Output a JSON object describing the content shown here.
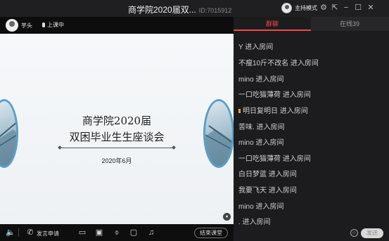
{
  "window": {
    "title": "商学院2020届双...",
    "room_id": "ID:7015912",
    "host_mode": "主持模式",
    "icons": [
      "settings-icon",
      "popout-icon",
      "minimize-icon",
      "maximize-icon",
      "close-icon"
    ]
  },
  "teacher": {
    "name": "芋头",
    "status": "上课中"
  },
  "slide": {
    "title_line1": "商学院2020届",
    "title_line2": "双困毕业生生座谈会",
    "date": "2020年6月"
  },
  "toolbar": {
    "apply_speak": "发言申请",
    "end_class": "结束课堂",
    "icons": [
      "speaker-icon",
      "phone-icon",
      "camera-icon",
      "screen-share-icon",
      "mic-icon",
      "chat-icon",
      "music-icon"
    ]
  },
  "sidebar": {
    "tabs": [
      {
        "label": "群聊",
        "active": true
      },
      {
        "label": "在线39",
        "active": false
      }
    ],
    "messages": [
      {
        "text": "Y 进入房间"
      },
      {
        "text": "不瘦10斤不改名 进入房间"
      },
      {
        "text": "mino 进入房间"
      },
      {
        "text": "一口吃猫薄荷 进入房间"
      },
      {
        "text": "明日复明日 进入房间",
        "badge": true
      },
      {
        "text": "苦味. 进入房间"
      },
      {
        "text": "mino 进入房间"
      },
      {
        "text": "一口吃猫薄荷 进入房间"
      },
      {
        "text": "白日梦蓝 进入房间"
      },
      {
        "text": "我要飞天 进入房间"
      },
      {
        "text": "mino 进入房间"
      },
      {
        "text": ". 进入房间"
      }
    ],
    "send_label": "发送"
  },
  "colors": {
    "accent": "#f04848",
    "badge": "#e8a23a",
    "oval_border": "#5c9fc6"
  }
}
